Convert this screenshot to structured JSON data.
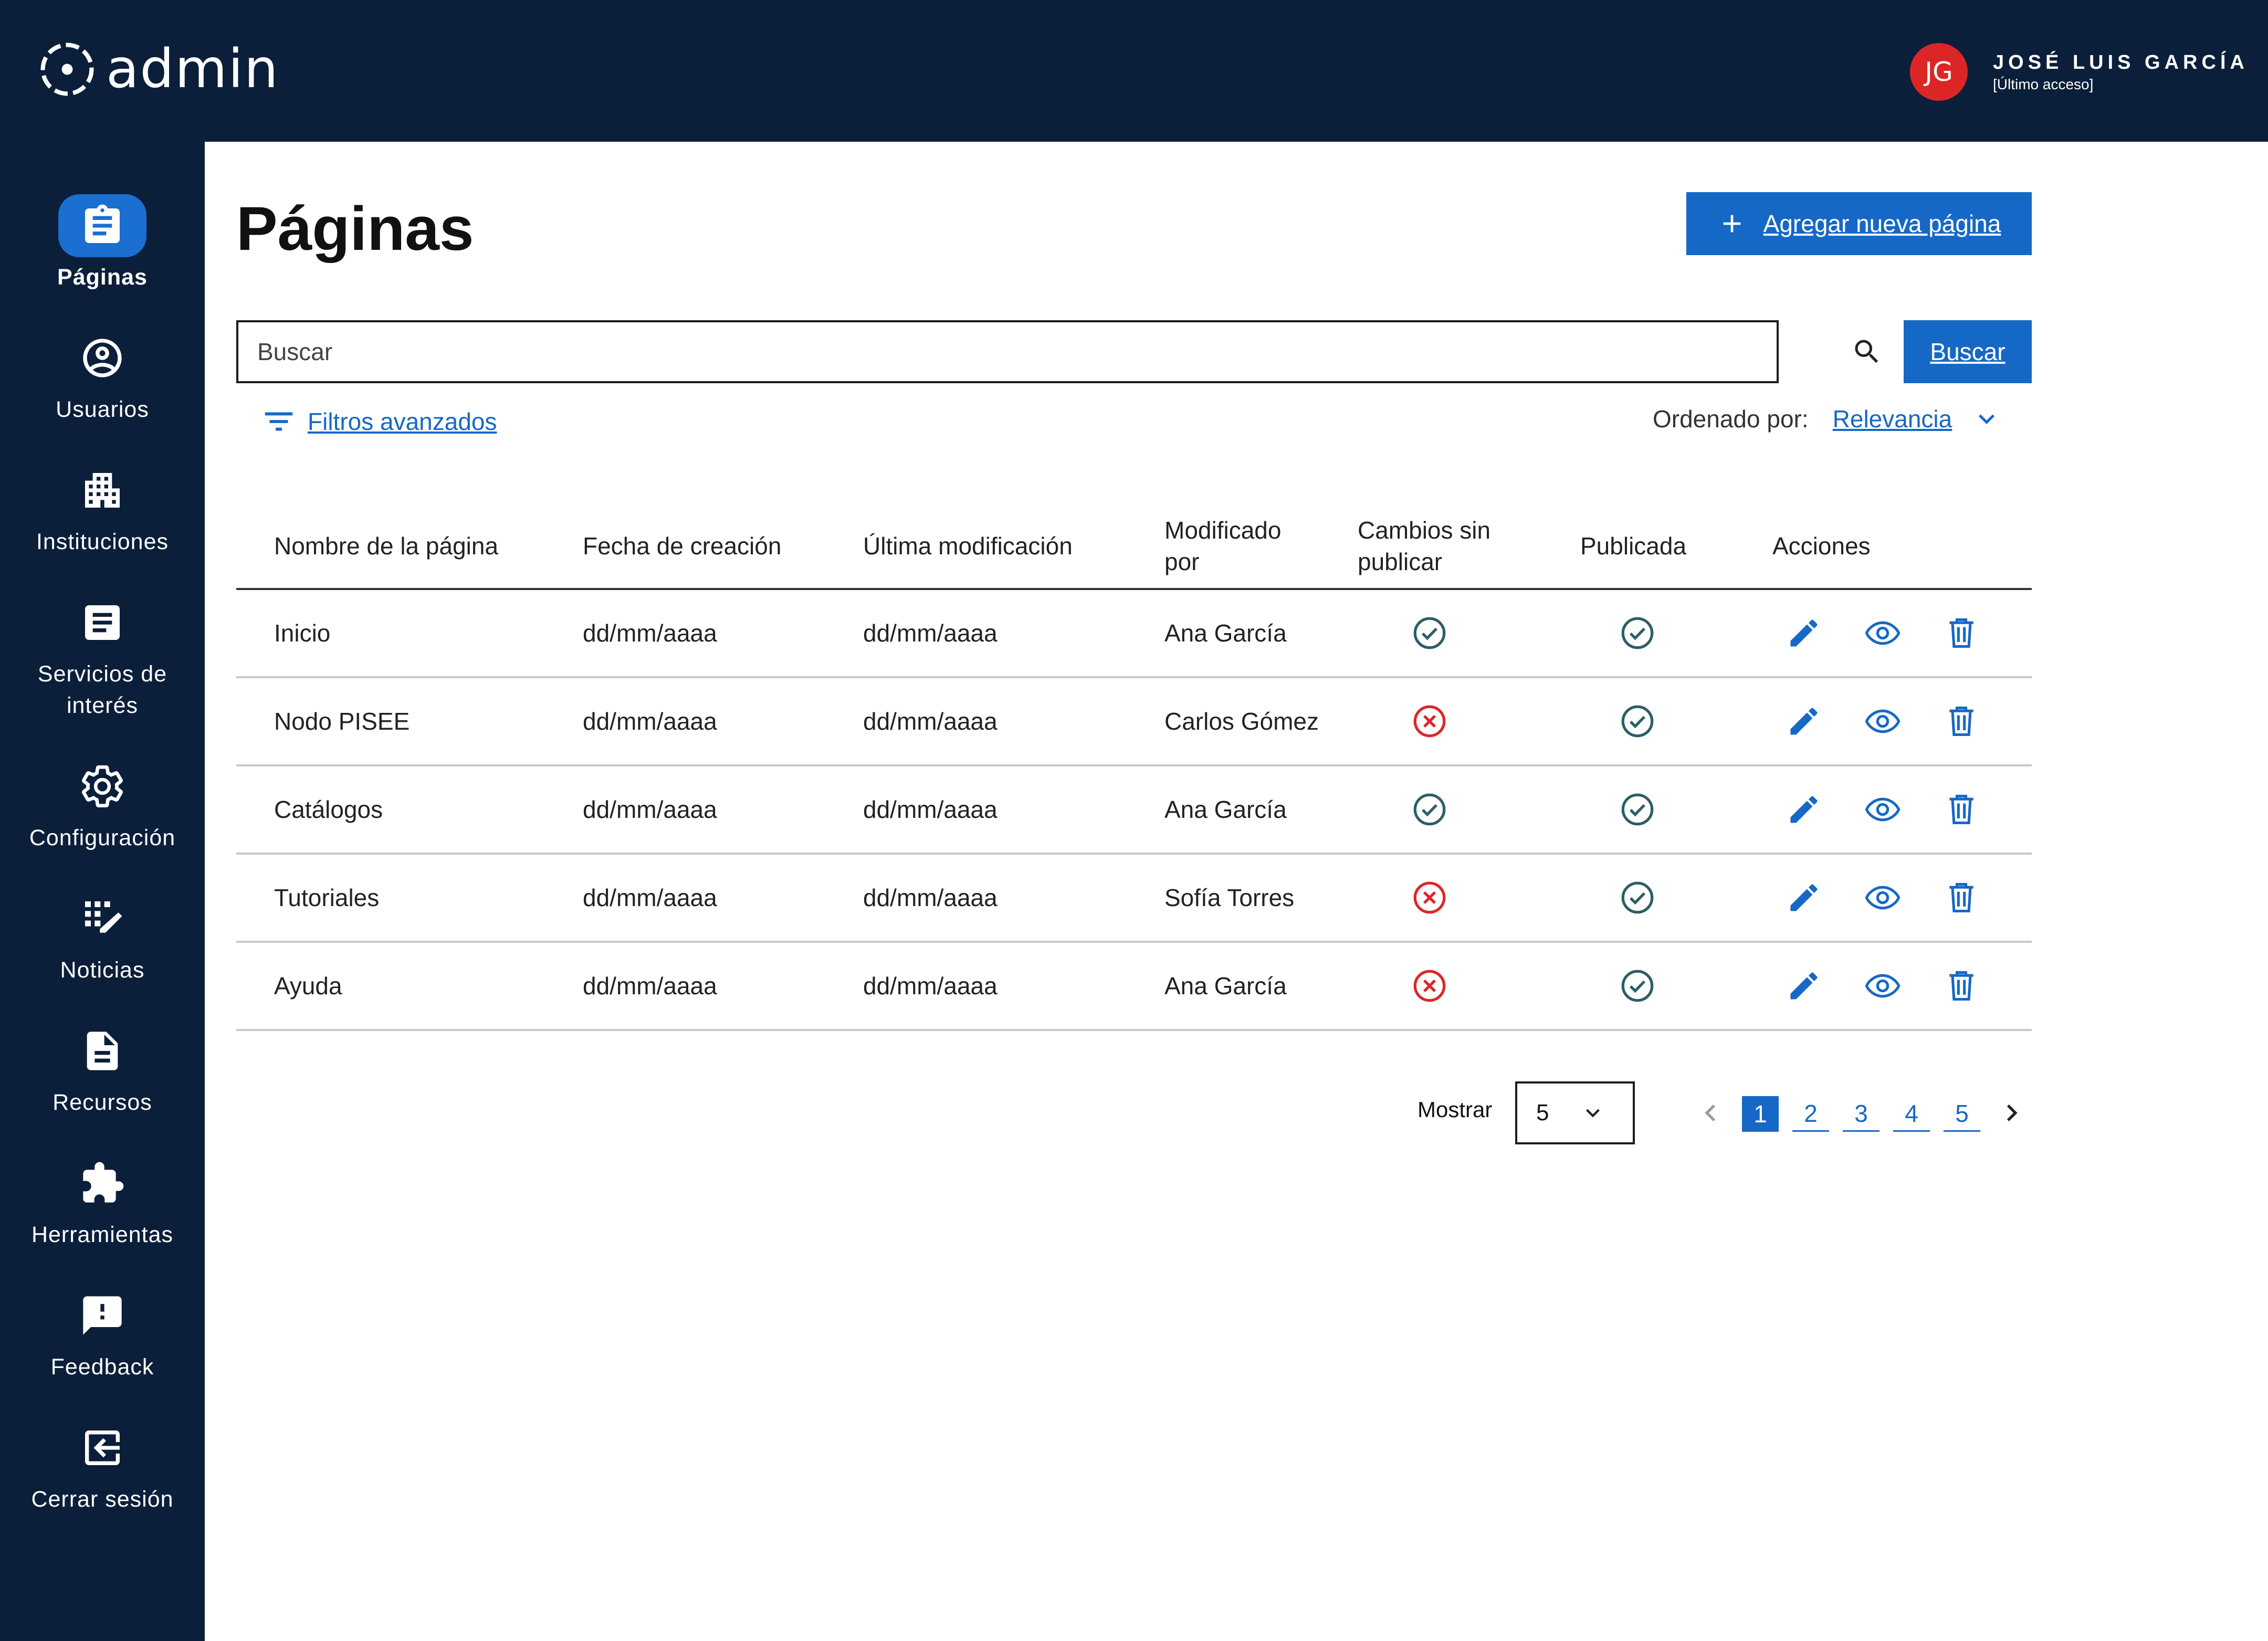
{
  "app": {
    "logo_text": "admin"
  },
  "user": {
    "initials": "JG",
    "name": "JOSÉ LUIS GARCÍA",
    "subtitle": "[Último acceso]"
  },
  "sidebar": {
    "items": [
      {
        "label": "Páginas",
        "icon": "clipboard-icon",
        "active": true
      },
      {
        "label": "Usuarios",
        "icon": "user-circle-icon"
      },
      {
        "label": "Instituciones",
        "icon": "building-icon"
      },
      {
        "label": "Servicios de interés",
        "icon": "article-icon"
      },
      {
        "label": "Configuración",
        "icon": "gear-icon"
      },
      {
        "label": "Noticias",
        "icon": "news-edit-icon"
      },
      {
        "label": "Recursos",
        "icon": "document-icon"
      },
      {
        "label": "Herramientas",
        "icon": "puzzle-icon"
      },
      {
        "label": "Feedback",
        "icon": "feedback-icon"
      },
      {
        "label": "Cerrar sesión",
        "icon": "logout-icon"
      }
    ]
  },
  "page": {
    "title": "Páginas",
    "add_button_label": "Agregar nueva página"
  },
  "search": {
    "placeholder": "Buscar",
    "button_label": "Buscar"
  },
  "filters": {
    "label": "Filtros avanzados"
  },
  "sort": {
    "label": "Ordenado por:",
    "value": "Relevancia"
  },
  "table": {
    "headers": {
      "name": "Nombre de la página",
      "created": "Fecha de creación",
      "modified": "Última modificación",
      "modified_by": "Modificado por",
      "unpublished_changes": "Cambios sin publicar",
      "published": "Publicada",
      "actions": "Acciones"
    },
    "rows": [
      {
        "name": "Inicio",
        "created": "dd/mm/aaaa",
        "modified": "dd/mm/aaaa",
        "modified_by": "Ana García",
        "unpublished_changes": true,
        "published": true
      },
      {
        "name": "Nodo PISEE",
        "created": "dd/mm/aaaa",
        "modified": "dd/mm/aaaa",
        "modified_by": "Carlos Gómez",
        "unpublished_changes": false,
        "published": true
      },
      {
        "name": "Catálogos",
        "created": "dd/mm/aaaa",
        "modified": "dd/mm/aaaa",
        "modified_by": "Ana García",
        "unpublished_changes": true,
        "published": true
      },
      {
        "name": "Tutoriales",
        "created": "dd/mm/aaaa",
        "modified": "dd/mm/aaaa",
        "modified_by": "Sofía Torres",
        "unpublished_changes": false,
        "published": true
      },
      {
        "name": "Ayuda",
        "created": "dd/mm/aaaa",
        "modified": "dd/mm/aaaa",
        "modified_by": "Ana García",
        "unpublished_changes": false,
        "published": true
      }
    ]
  },
  "pagination": {
    "show_label": "Mostrar",
    "page_size": "5",
    "pages": [
      "1",
      "2",
      "3",
      "4",
      "5"
    ],
    "current_page": "1"
  },
  "colors": {
    "nav_background": "#0b1f3a",
    "accent": "#1668c6",
    "active_nav": "#1a6fd1",
    "avatar": "#dc2626",
    "check": "#2b5f66",
    "error": "#dc2626"
  }
}
